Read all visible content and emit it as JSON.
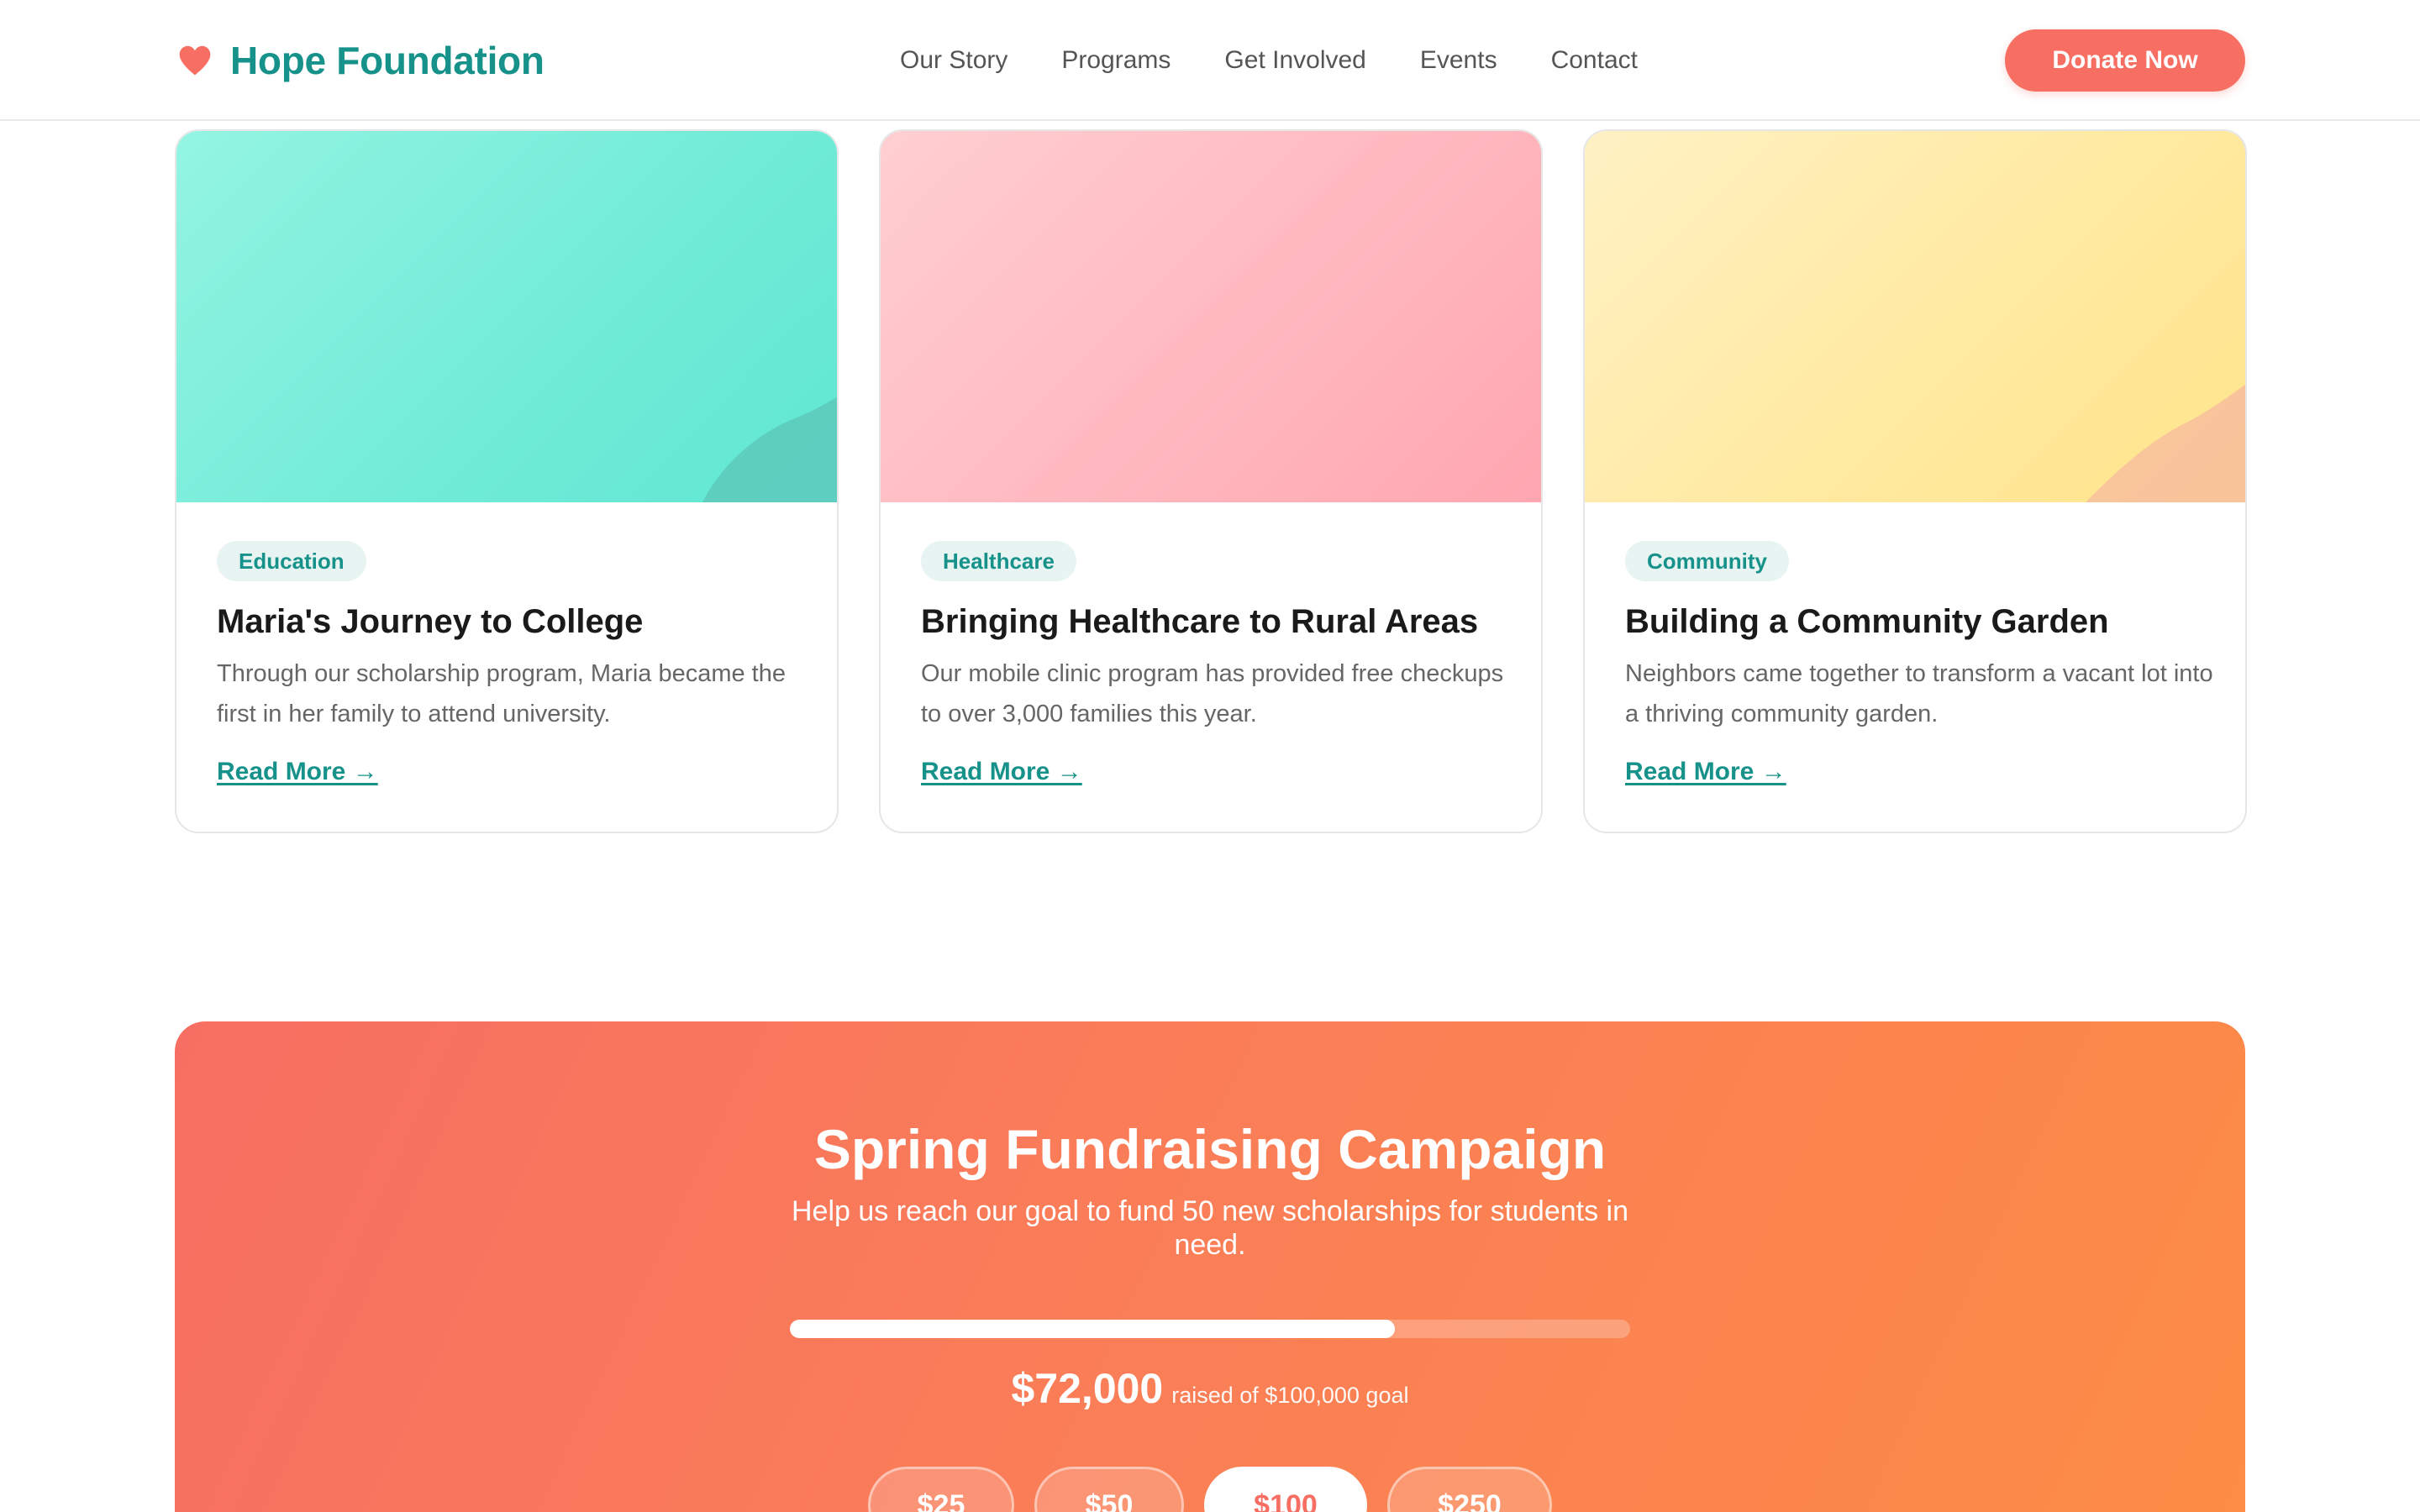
{
  "brand": {
    "name": "Hope Foundation",
    "icon": "heart-icon",
    "color": "#17928a",
    "accent": "#f76e63"
  },
  "nav": {
    "items": [
      "Our Story",
      "Programs",
      "Get Involved",
      "Events",
      "Contact"
    ],
    "donate_label": "Donate Now"
  },
  "stories": [
    {
      "tag": "Education",
      "title": "Maria's Journey to College",
      "description": "Through our scholarship program, Maria became the first in her family to attend university.",
      "link": "Read More →",
      "image_color": "#72ecd8"
    },
    {
      "tag": "Healthcare",
      "title": "Bringing Healthcare to Rural Areas",
      "description": "Our mobile clinic program has provided free checkups to over 3,000 families this year.",
      "link": "Read More →",
      "image_color": "#ffb8bf"
    },
    {
      "tag": "Community",
      "title": "Building a Community Garden",
      "description": "Neighbors came together to transform a vacant lot into a thriving community garden.",
      "link": "Read More →",
      "image_color": "#ffeaa1"
    }
  ],
  "campaign": {
    "title": "Spring Fundraising Campaign",
    "subtitle": "Help us reach our goal to fund 50 new scholarships for students in need.",
    "raised": "$72,000",
    "goal_text": "raised of $100,000 goal",
    "progress_percent": 72,
    "amounts": [
      "$25",
      "$50",
      "$100",
      "$250"
    ],
    "selected_amount": "$100"
  }
}
